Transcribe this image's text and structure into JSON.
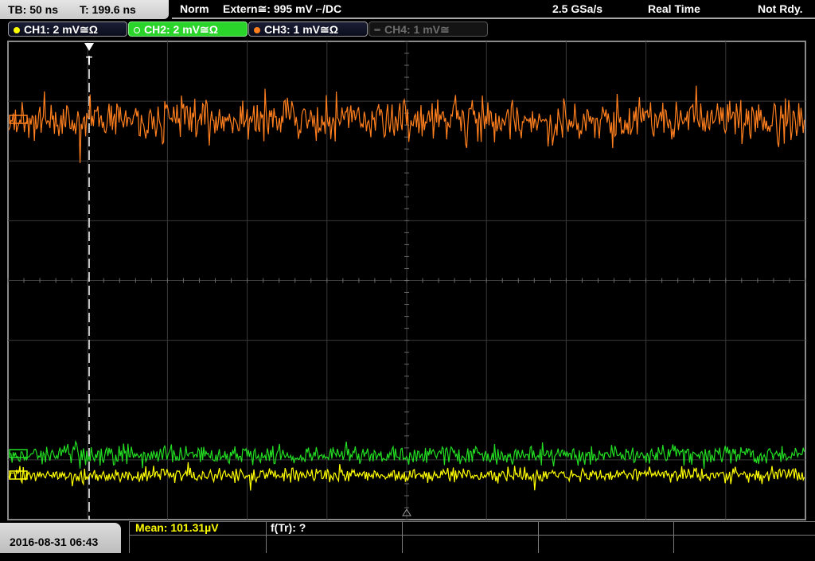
{
  "topbar": {
    "timebase": "TB: 50 ns",
    "trigger_time": "T: 199.6 ns",
    "trigger_mode": "Norm",
    "trigger_source": "Extern≅: 995 mV ⌐/DC",
    "sample_rate": "2.5 GSa/s",
    "acq_mode": "Real Time",
    "status": "Not Rdy."
  },
  "channels": [
    {
      "label": "CH1: 2 mV≅Ω",
      "color": "#ffff00",
      "state": "on"
    },
    {
      "label": "CH2: 2 mV≅Ω",
      "color": "#22cc22",
      "state": "selected"
    },
    {
      "label": "CH3: 1 mV≅Ω",
      "color": "#ff7f1e",
      "state": "on"
    },
    {
      "label": "CH4: 1 mV≅",
      "color": "#6d6d6d",
      "state": "off"
    }
  ],
  "markers": {
    "trigger_marker": "T"
  },
  "traces": {
    "ch3_color": "#ff7f1e",
    "ch2_color": "#22dd22",
    "ch1_color": "#ffff00"
  },
  "bottombar": {
    "datetime": "2016-08-31 06:43",
    "measurement_mean": "Mean: 101.31µV",
    "measurement_freq": "f(Tr): ?"
  }
}
